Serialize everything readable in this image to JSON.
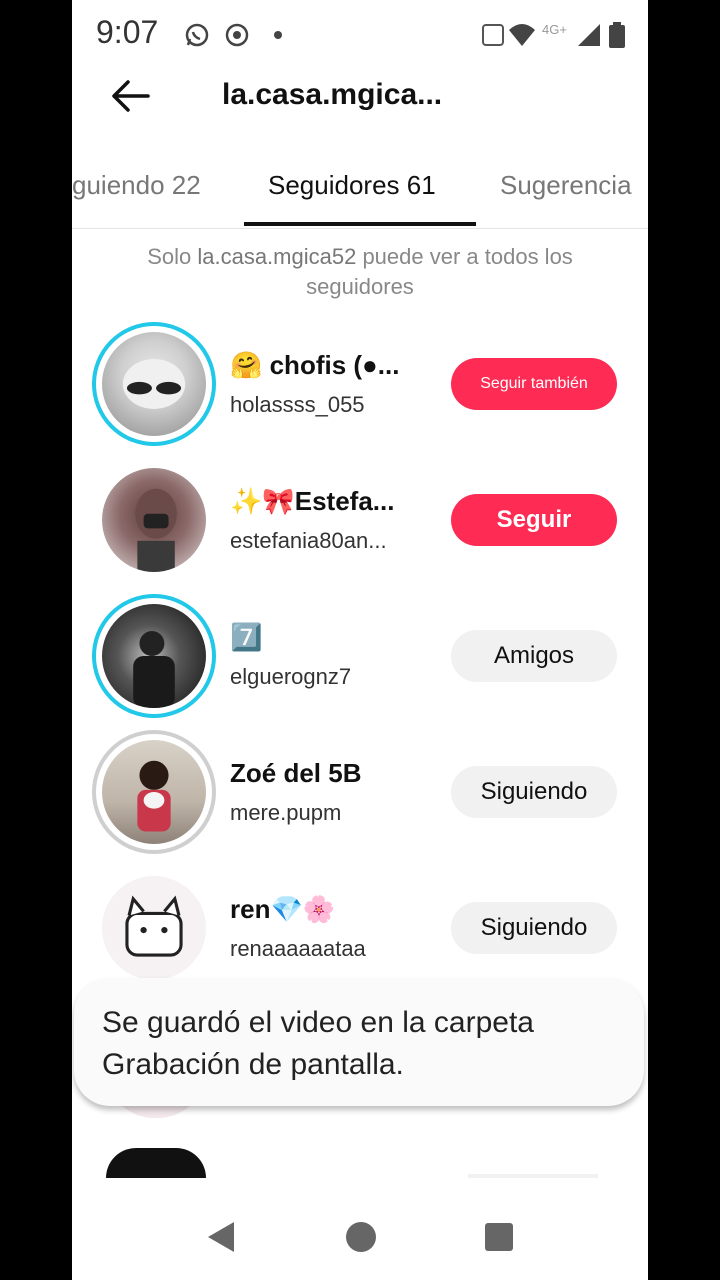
{
  "status": {
    "time": "9:07",
    "network": "4G+"
  },
  "header": {
    "title": "la.casa.mgica..."
  },
  "tabs": [
    {
      "label": "guiendo 22"
    },
    {
      "label": "Seguidores 61"
    },
    {
      "label": "Sugerencia"
    }
  ],
  "notice": {
    "pre": "Solo ",
    "username": "la.casa.mgica52",
    "post": " puede ver a todos los seguidores"
  },
  "followers": [
    {
      "name": "🤗 chofis (●...",
      "handle": "holassss_055",
      "button": "Seguir también",
      "button_style": "red"
    },
    {
      "name": "✨🎀Estefa...",
      "handle": "estefania80an...",
      "button": "Seguir",
      "button_style": "red"
    },
    {
      "name": "7️⃣",
      "handle": "elguerognz7",
      "button": "Amigos",
      "button_style": "gray"
    },
    {
      "name": "Zoé del 5B",
      "handle": "mere.pupm",
      "button": "Siguiendo",
      "button_style": "gray"
    },
    {
      "name": "ren💎🌸",
      "handle": "renaaaaaataa",
      "button": "Siguiendo",
      "button_style": "gray"
    }
  ],
  "toast": {
    "message": "Se guardó el video en la carpeta Grabación de pantalla."
  },
  "icons": [
    "whatsapp-icon",
    "screen-record-icon",
    "wifi-icon",
    "signal-icon",
    "battery-icon",
    "back-arrow-icon",
    "nav-back-icon",
    "nav-home-icon",
    "nav-recents-icon"
  ],
  "colors": {
    "accent": "#fe2c55",
    "story_ring": "#21c8e8"
  }
}
